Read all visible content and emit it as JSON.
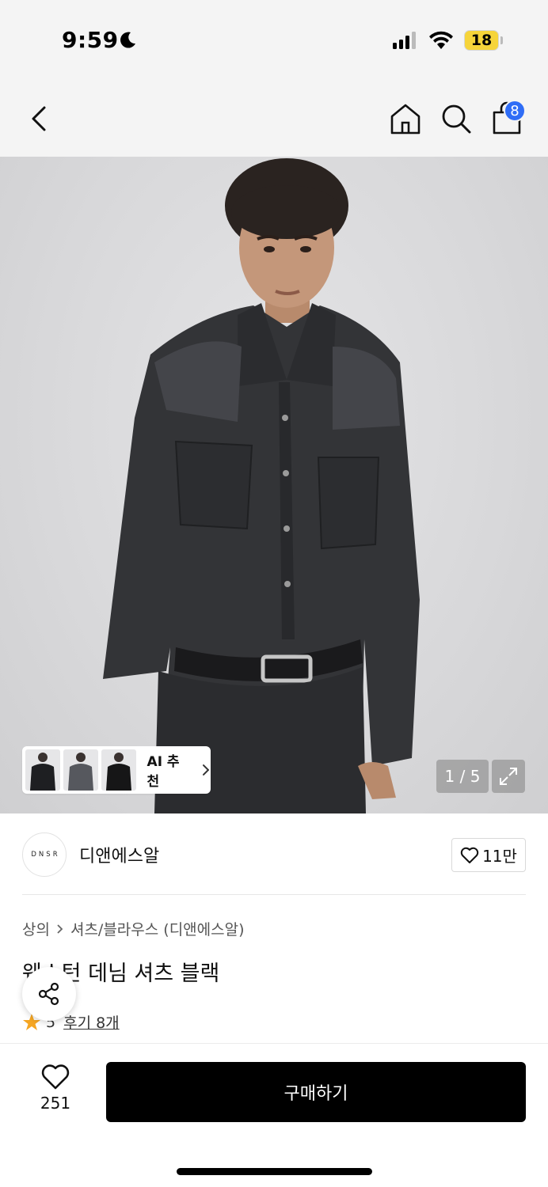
{
  "status": {
    "time": "9:59",
    "battery": "18"
  },
  "header": {
    "cart_count": "8"
  },
  "gallery": {
    "ai_label": "AI 추천",
    "page_indicator": "1 / 5"
  },
  "brand": {
    "logo_text": "DNSR",
    "name": "디앤에스알",
    "likes": "11만"
  },
  "product": {
    "breadcrumb": [
      "상의",
      "셔츠/블라우스 (디앤에스알)"
    ],
    "title": "웨스턴 데님 셔츠 블랙",
    "rating": "5",
    "review_link": "후기 8개"
  },
  "bottom": {
    "wish_count": "251",
    "buy_label": "구매하기"
  },
  "colors": {
    "badge": "#2f6df6",
    "star": "#f5a623",
    "buy_button": "#000000"
  },
  "icons": [
    "moon-icon",
    "back-icon",
    "home-icon",
    "search-icon",
    "cart-icon",
    "expand-icon",
    "heart-icon",
    "share-icon",
    "star-icon",
    "chevron-right-icon"
  ]
}
